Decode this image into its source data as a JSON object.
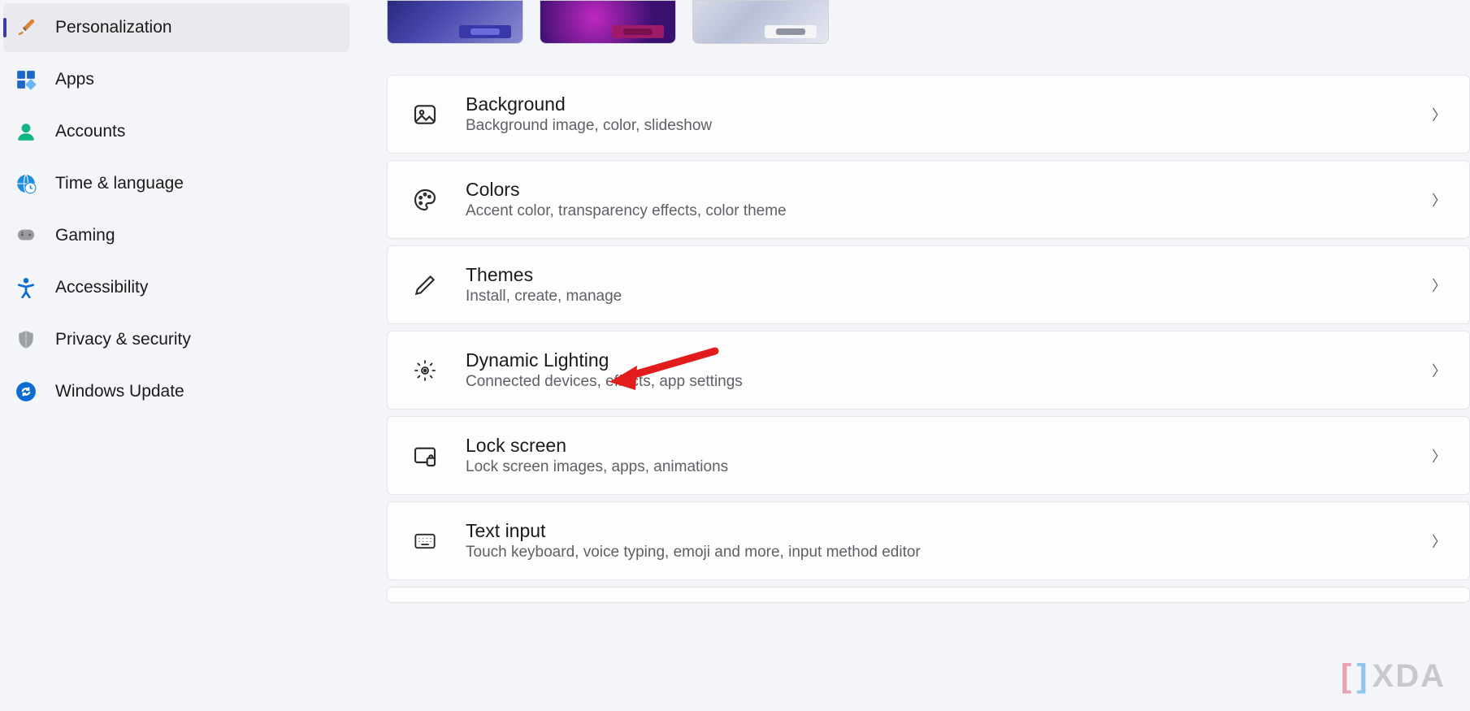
{
  "sidebar": {
    "items": [
      {
        "label": "Personalization",
        "icon": "brush-icon"
      },
      {
        "label": "Apps",
        "icon": "apps-icon"
      },
      {
        "label": "Accounts",
        "icon": "person-icon"
      },
      {
        "label": "Time & language",
        "icon": "globe-clock-icon"
      },
      {
        "label": "Gaming",
        "icon": "gamepad-icon"
      },
      {
        "label": "Accessibility",
        "icon": "accessibility-icon"
      },
      {
        "label": "Privacy & security",
        "icon": "shield-icon"
      },
      {
        "label": "Windows Update",
        "icon": "update-sync-icon"
      }
    ]
  },
  "content": {
    "cards": [
      {
        "title": "Background",
        "desc": "Background image, color, slideshow",
        "icon": "picture-icon"
      },
      {
        "title": "Colors",
        "desc": "Accent color, transparency effects, color theme",
        "icon": "palette-icon"
      },
      {
        "title": "Themes",
        "desc": "Install, create, manage",
        "icon": "pen-icon"
      },
      {
        "title": "Dynamic Lighting",
        "desc": "Connected devices, effects, app settings",
        "icon": "sparkle-icon"
      },
      {
        "title": "Lock screen",
        "desc": "Lock screen images, apps, animations",
        "icon": "lockscreen-icon"
      },
      {
        "title": "Text input",
        "desc": "Touch keyboard, voice typing, emoji and more, input method editor",
        "icon": "keyboard-icon"
      }
    ]
  },
  "annotation": {
    "arrow_target": "Dynamic Lighting"
  },
  "watermark": {
    "text": "XDA"
  }
}
